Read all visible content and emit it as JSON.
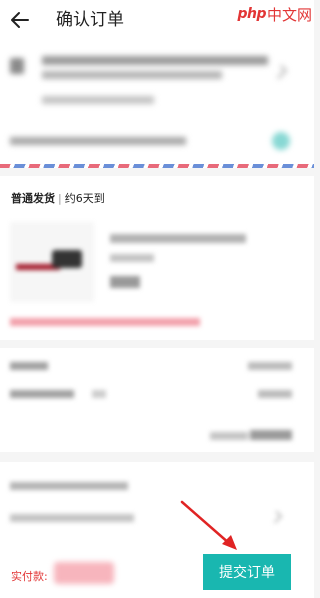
{
  "header": {
    "title": "确认订单",
    "back_icon": "back-arrow-icon",
    "logo_php": "php",
    "logo_cn": "中文网"
  },
  "shipping": {
    "type": "普通发货",
    "separator": "|",
    "eta": "约6天到"
  },
  "footer": {
    "pay_label": "实付款:",
    "submit_label": "提交订单"
  },
  "colors": {
    "accent": "#19b7b0",
    "price_red": "#e23535",
    "annotation_arrow": "#e02424"
  }
}
